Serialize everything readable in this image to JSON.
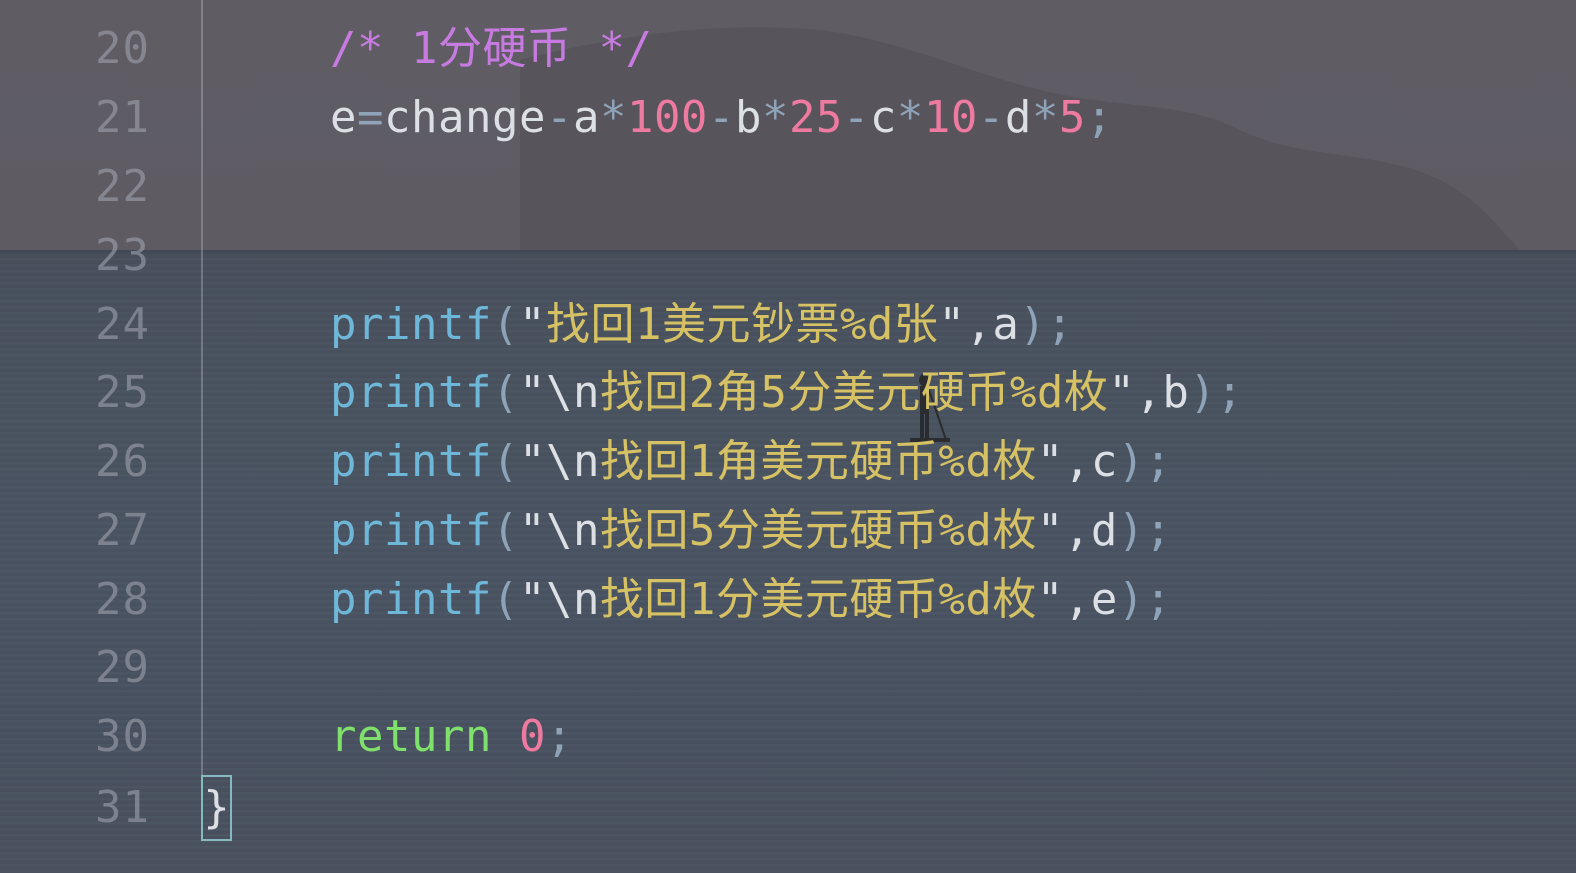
{
  "editor": {
    "line_numbers": [
      "20",
      "21",
      "22",
      "23",
      "24",
      "25",
      "26",
      "27",
      "28",
      "29",
      "30",
      "31"
    ],
    "lines": {
      "l20": {
        "comment": "/* 1分硬币 */"
      },
      "l21": {
        "t1": "e",
        "t2": "=",
        "t3": "change",
        "t4": "-",
        "t5": "a",
        "t6": "*",
        "t7": "100",
        "t8": "-",
        "t9": "b",
        "t10": "*",
        "t11": "25",
        "t12": "-",
        "t13": "c",
        "t14": "*",
        "t15": "10",
        "t16": "-",
        "t17": "d",
        "t18": "*",
        "t19": "5",
        "t20": ";"
      },
      "l24": {
        "fn": "printf",
        "open": "(",
        "q1": "\"",
        "str": "找回1美元钞票%d张",
        "q2": "\"",
        "rest": ",a",
        "close": ");"
      },
      "l25": {
        "fn": "printf",
        "open": "(",
        "q1": "\"",
        "esc": "\\n",
        "str": "找回2角5分美元硬币%d枚",
        "q2": "\"",
        "rest": ",b",
        "close": ");"
      },
      "l26": {
        "fn": "printf",
        "open": "(",
        "q1": "\"",
        "esc": "\\n",
        "str": "找回1角美元硬币%d枚",
        "q2": "\"",
        "rest": ",c",
        "close": ");"
      },
      "l27": {
        "fn": "printf",
        "open": "(",
        "q1": "\"",
        "esc": "\\n",
        "str": "找回5分美元硬币%d枚",
        "q2": "\"",
        "rest": ",d",
        "close": ");"
      },
      "l28": {
        "fn": "printf",
        "open": "(",
        "q1": "\"",
        "esc": "\\n",
        "str": "找回1分美元硬币%d枚",
        "q2": "\"",
        "rest": ",e",
        "close": ");"
      },
      "l30": {
        "kw": "return",
        "num": "0",
        "semi": ";"
      },
      "l31": {
        "brace": "}"
      }
    }
  },
  "colors": {
    "comment": "#c77be0",
    "number": "#ef7aa0",
    "function": "#6fb7d8",
    "string": "#d6c264",
    "keyword": "#7fe06c",
    "text": "#dcdfe4"
  },
  "background": "seascape-wallpaper"
}
